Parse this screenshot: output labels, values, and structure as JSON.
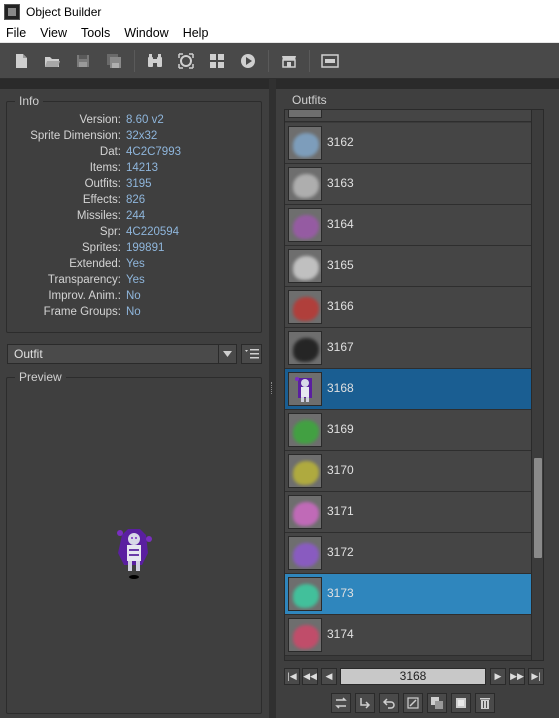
{
  "window": {
    "title": "Object Builder"
  },
  "menu": [
    "File",
    "View",
    "Tools",
    "Window",
    "Help"
  ],
  "toolbar": {
    "icons": [
      "new-file-icon",
      "open-folder-icon",
      "save-icon",
      "save-as-icon",
      "object-finder-icon",
      "sprite-finder-icon",
      "sprite-viewer-icon",
      "animation-editor-icon",
      "store-icon",
      "lua-icon"
    ]
  },
  "info": {
    "title": "Info",
    "rows": [
      {
        "label": "Version:",
        "value": "8.60 v2"
      },
      {
        "label": "Sprite Dimension:",
        "value": "32x32"
      },
      {
        "label": "Dat:",
        "value": "4C2C7993"
      },
      {
        "label": "Items:",
        "value": "14213"
      },
      {
        "label": "Outfits:",
        "value": "3195"
      },
      {
        "label": "Effects:",
        "value": "826"
      },
      {
        "label": "Missiles:",
        "value": "244"
      },
      {
        "label": "Spr:",
        "value": "4C220594"
      },
      {
        "label": "Sprites:",
        "value": "199891"
      },
      {
        "label": "Extended:",
        "value": "Yes"
      },
      {
        "label": "Transparency:",
        "value": "Yes"
      },
      {
        "label": "Improv. Anim.:",
        "value": "No"
      },
      {
        "label": "Frame Groups:",
        "value": "No"
      }
    ]
  },
  "category": {
    "selected": "Outfit"
  },
  "preview": {
    "title": "Preview"
  },
  "outfits": {
    "title": "Outfits",
    "items": [
      {
        "id": "3162",
        "color": "#7fa3c4"
      },
      {
        "id": "3163",
        "color": "#b5b5b5"
      },
      {
        "id": "3164",
        "color": "#9a5aa8"
      },
      {
        "id": "3165",
        "color": "#c9c9c9"
      },
      {
        "id": "3166",
        "color": "#b83a36"
      },
      {
        "id": "3167",
        "color": "#1e1e1e"
      },
      {
        "id": "3168",
        "color": "#6a3aa8"
      },
      {
        "id": "3169",
        "color": "#3ea63e"
      },
      {
        "id": "3170",
        "color": "#b7b13a"
      },
      {
        "id": "3171",
        "color": "#c96ac0"
      },
      {
        "id": "3172",
        "color": "#8c5ac9"
      },
      {
        "id": "3173",
        "color": "#3ec9a0"
      },
      {
        "id": "3174",
        "color": "#c94a6a"
      }
    ],
    "selected": "3168",
    "highlighted": "3173"
  },
  "pager": {
    "value": "3168"
  },
  "actions": [
    "replace-icon",
    "export-icon",
    "undo-icon",
    "edit-icon",
    "duplicate-icon",
    "new-object-icon",
    "delete-icon"
  ]
}
